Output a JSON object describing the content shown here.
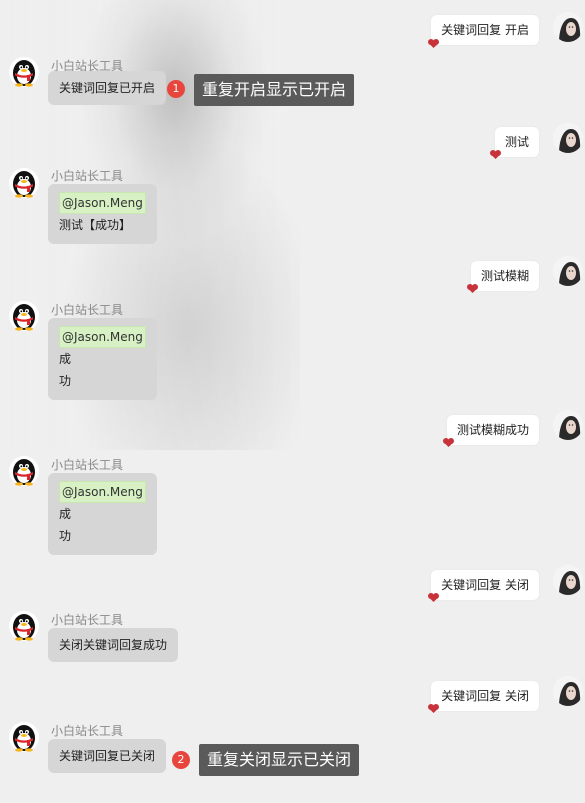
{
  "bot_name": "小白站长工具",
  "mention": "@Jason.Meng",
  "messages": {
    "u1": "关键词回复 开启",
    "b1": "关键词回复已开启",
    "u2": "测试",
    "b2_line": "测试【成功】",
    "u3": "测试模糊",
    "b3_l1": "成",
    "b3_l2": "功",
    "u4": "测试模糊成功",
    "b4_l1": "成",
    "b4_l2": "功",
    "u5": "关键词回复 关闭",
    "b5": "关闭关键词回复成功",
    "u6": "关键词回复 关闭",
    "b6": "关键词回复已关闭"
  },
  "annotations": {
    "a1_num": "1",
    "a1_text": "重复开启显示已开启",
    "a2_num": "2",
    "a2_text": "重复关闭显示已关闭"
  },
  "colors": {
    "background": "#efefef",
    "bot_bubble": "#d6d6d6",
    "user_bubble": "#ffffff",
    "mention_bg": "#d7f0c4",
    "badge": "#e8453c",
    "callout_bg": "#5a5a5a"
  },
  "icons": {
    "bot_avatar": "penguin-avatar-icon",
    "user_avatar": "user-portrait-avatar-icon",
    "heart": "heart-icon"
  }
}
